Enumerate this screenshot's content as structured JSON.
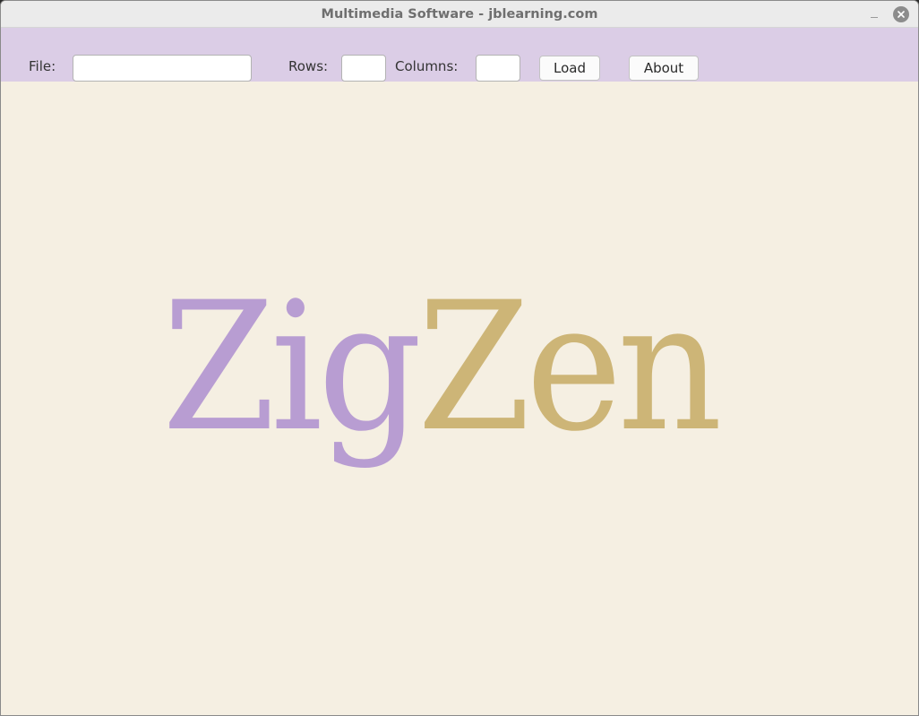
{
  "window": {
    "title": "Multimedia Software - jblearning.com",
    "minimize_glyph": "–",
    "close_icon": "close-icon"
  },
  "toolbar": {
    "file_label": "File:",
    "file_value": "",
    "rows_label": "Rows:",
    "rows_value": "",
    "columns_label": "Columns:",
    "columns_value": "",
    "load_label": "Load",
    "about_label": "About",
    "background_color": "#dbcde6"
  },
  "canvas": {
    "background_color": "#f5efe2",
    "logo_part1": "Zig",
    "logo_part2": "Zen",
    "logo_part1_color": "#b89dd2",
    "logo_part2_color": "#cdb577"
  }
}
